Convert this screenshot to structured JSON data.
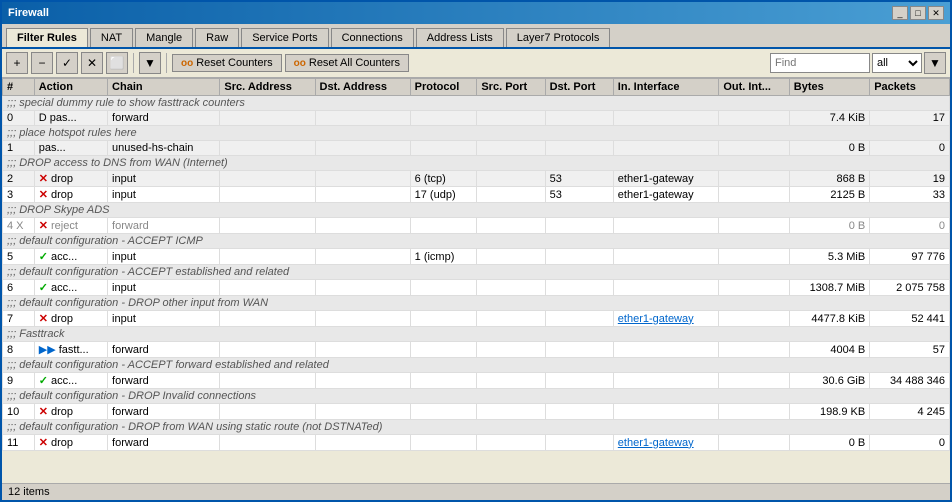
{
  "window": {
    "title": "Firewall",
    "controls": [
      "_",
      "□",
      "✕"
    ]
  },
  "tabs": [
    {
      "label": "Filter Rules",
      "active": true
    },
    {
      "label": "NAT",
      "active": false
    },
    {
      "label": "Mangle",
      "active": false
    },
    {
      "label": "Raw",
      "active": false
    },
    {
      "label": "Service Ports",
      "active": false
    },
    {
      "label": "Connections",
      "active": false
    },
    {
      "label": "Address Lists",
      "active": false
    },
    {
      "label": "Layer7 Protocols",
      "active": false
    }
  ],
  "toolbar": {
    "add_label": "+",
    "remove_label": "−",
    "check_label": "✓",
    "x_label": "✕",
    "copy_label": "⬜",
    "filter_label": "▼",
    "reset_counters_label": "Reset Counters",
    "reset_all_label": "Reset All Counters",
    "find_placeholder": "Find",
    "find_filter": "all"
  },
  "columns": [
    "#",
    "Action",
    "Chain",
    "Src. Address",
    "Dst. Address",
    "Protocol",
    "Src. Port",
    "Dst. Port",
    "In. Interface",
    "Out. Int...",
    "Bytes",
    "Packets"
  ],
  "rows": [
    {
      "type": "section",
      "text": ";;; special dummy rule to show fasttrack counters"
    },
    {
      "type": "data",
      "num": "0",
      "action_icon": "D",
      "action_text": "pas...",
      "chain": "forward",
      "src_addr": "",
      "dst_addr": "",
      "protocol": "",
      "src_port": "",
      "dst_port": "",
      "in_iface": "",
      "out_iface": "",
      "bytes": "7.4 KiB",
      "packets": "17",
      "disabled": false
    },
    {
      "type": "section",
      "text": ";;; place hotspot rules here"
    },
    {
      "type": "data",
      "num": "1",
      "action_icon": "",
      "action_text": "pas...",
      "chain": "unused-hs-chain",
      "src_addr": "",
      "dst_addr": "",
      "protocol": "",
      "src_port": "",
      "dst_port": "",
      "in_iface": "",
      "out_iface": "",
      "bytes": "0 B",
      "packets": "0",
      "disabled": false
    },
    {
      "type": "section",
      "text": ";;; DROP access to DNS from WAN (Internet)"
    },
    {
      "type": "data",
      "num": "2",
      "action_icon": "x",
      "action_text": "drop",
      "chain": "input",
      "src_addr": "",
      "dst_addr": "",
      "protocol": "6 (tcp)",
      "src_port": "",
      "dst_port": "53",
      "in_iface": "ether1-gateway",
      "out_iface": "",
      "bytes": "868 B",
      "packets": "19",
      "disabled": false
    },
    {
      "type": "data",
      "num": "3",
      "action_icon": "x",
      "action_text": "drop",
      "chain": "input",
      "src_addr": "",
      "dst_addr": "",
      "protocol": "17 (udp)",
      "src_port": "",
      "dst_port": "53",
      "in_iface": "ether1-gateway",
      "out_iface": "",
      "bytes": "2125 B",
      "packets": "33",
      "disabled": false
    },
    {
      "type": "section",
      "text": ";;; DROP Skype ADS"
    },
    {
      "type": "data",
      "num": "4",
      "disabled_flag": "X",
      "action_icon": "reject_x",
      "action_text": "reject",
      "chain": "forward",
      "src_addr": "",
      "dst_addr": "",
      "protocol": "",
      "src_port": "",
      "dst_port": "",
      "in_iface": "",
      "out_iface": "",
      "bytes": "0 B",
      "packets": "0",
      "disabled": true
    },
    {
      "type": "section",
      "text": ";;; default configuration - ACCEPT ICMP"
    },
    {
      "type": "data",
      "num": "5",
      "action_icon": "check",
      "action_text": "acc...",
      "chain": "input",
      "src_addr": "",
      "dst_addr": "",
      "protocol": "1 (icmp)",
      "src_port": "",
      "dst_port": "",
      "in_iface": "",
      "out_iface": "",
      "bytes": "5.3 MiB",
      "packets": "97 776",
      "disabled": false
    },
    {
      "type": "section",
      "text": ";;; default configuration - ACCEPT established and related"
    },
    {
      "type": "data",
      "num": "6",
      "action_icon": "check",
      "action_text": "acc...",
      "chain": "input",
      "src_addr": "",
      "dst_addr": "",
      "protocol": "",
      "src_port": "",
      "dst_port": "",
      "in_iface": "",
      "out_iface": "",
      "bytes": "1308.7 MiB",
      "packets": "2 075 758",
      "disabled": false
    },
    {
      "type": "section",
      "text": ";;; default configuration - DROP other input from WAN"
    },
    {
      "type": "data",
      "num": "7",
      "action_icon": "x",
      "action_text": "drop",
      "chain": "input",
      "src_addr": "",
      "dst_addr": "",
      "protocol": "",
      "src_port": "",
      "dst_port": "",
      "in_iface": "ether1-gateway",
      "in_iface_highlight": true,
      "out_iface": "",
      "bytes": "4477.8 KiB",
      "packets": "52 441",
      "disabled": false
    },
    {
      "type": "section",
      "text": ";;; Fasttrack"
    },
    {
      "type": "data",
      "num": "8",
      "action_icon": "fast",
      "action_text": "fastt...",
      "chain": "forward",
      "src_addr": "",
      "dst_addr": "",
      "protocol": "",
      "src_port": "",
      "dst_port": "",
      "in_iface": "",
      "out_iface": "",
      "bytes": "4004 B",
      "packets": "57",
      "disabled": false
    },
    {
      "type": "section",
      "text": ";;; default configuration - ACCEPT forward established and related"
    },
    {
      "type": "data",
      "num": "9",
      "action_icon": "check",
      "action_text": "acc...",
      "chain": "forward",
      "src_addr": "",
      "dst_addr": "",
      "protocol": "",
      "src_port": "",
      "dst_port": "",
      "in_iface": "",
      "out_iface": "",
      "bytes": "30.6 GiB",
      "packets": "34 488 346",
      "disabled": false
    },
    {
      "type": "section",
      "text": ";;; default configuration - DROP Invalid connections"
    },
    {
      "type": "data",
      "num": "10",
      "action_icon": "x",
      "action_text": "drop",
      "chain": "forward",
      "src_addr": "",
      "dst_addr": "",
      "protocol": "",
      "src_port": "",
      "dst_port": "",
      "in_iface": "",
      "out_iface": "",
      "bytes": "198.9 KB",
      "packets": "4 245",
      "disabled": false
    },
    {
      "type": "section",
      "text": ";;; default configuration - DROP from WAN using static route (not DSTNATed)"
    },
    {
      "type": "data",
      "num": "11",
      "action_icon": "x",
      "action_text": "drop",
      "chain": "forward",
      "src_addr": "",
      "dst_addr": "",
      "protocol": "",
      "src_port": "",
      "dst_port": "",
      "in_iface": "ether1-gateway",
      "in_iface_highlight": true,
      "out_iface": "",
      "bytes": "0 B",
      "packets": "0",
      "disabled": false
    }
  ],
  "status_bar": {
    "text": "12 items"
  }
}
